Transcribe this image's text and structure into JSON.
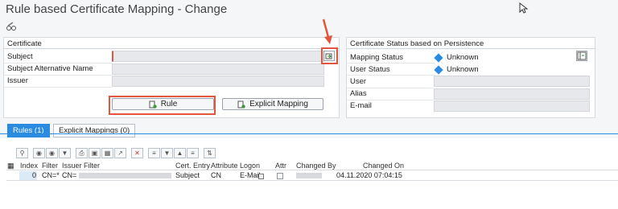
{
  "window": {
    "title": "Rule based Certificate Mapping - Change"
  },
  "icons": [
    "pencil-glasses-icon",
    "mouse-cursor-icon",
    "copy-icon",
    "sidebar-toggle-icon",
    "rule-icon",
    "explicit-mapping-icon",
    "search-icon",
    "filter-icon",
    "print-icon",
    "export-icon",
    "delete-icon",
    "sort-icon",
    "calendar-icon"
  ],
  "certificate": {
    "title": "Certificate",
    "subject_label": "Subject",
    "subject_alt_label": "Subject Alternative Name",
    "issuer_label": "Issuer",
    "rule_button": "Rule",
    "explicit_button": "Explicit Mapping"
  },
  "status": {
    "title": "Certificate Status based on Persistence",
    "mapping_label": "Mapping Status",
    "mapping_value": "Unknown",
    "user_status_label": "User Status",
    "user_status_value": "Unknown",
    "user_label": "User",
    "alias_label": "Alias",
    "email_label": "E-mail"
  },
  "tabs": [
    {
      "label": "Rules (1)",
      "active": true
    },
    {
      "label": "Explicit Mappings (0)",
      "active": false
    }
  ],
  "table": {
    "headers": [
      "Index",
      "Filter",
      "Issuer Filter",
      "Cert. Entry",
      "Attribute",
      "Logon",
      "Attr",
      "Changed By",
      "Changed On"
    ],
    "row": {
      "index": "0",
      "filter": "CN=*",
      "issuer": "CN=",
      "cert_entry": "Subject",
      "attribute": "CN",
      "logon": "E-Mail",
      "changed_on": "04.11.2020 07:04:15"
    }
  },
  "colors": {
    "accent": "#2a8be0",
    "highlight": "#e0563f"
  }
}
